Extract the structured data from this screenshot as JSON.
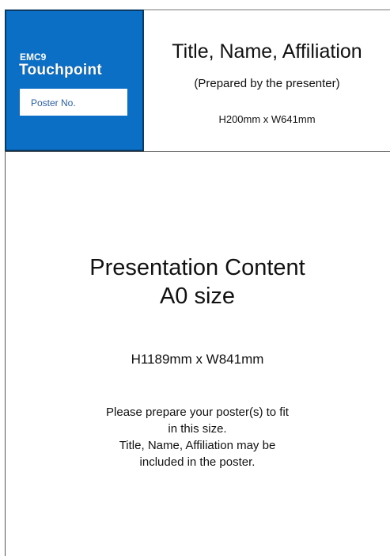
{
  "header": {
    "logo": {
      "brand_small": "EMC9",
      "brand_main": "Touchpoint",
      "poster_no_label": "Poster No."
    },
    "title": "Title, Name, Affiliation",
    "subtitle": "(Prepared by the presenter)",
    "size": "H200mm x W641mm"
  },
  "content": {
    "title_line1": "Presentation Content",
    "title_line2": "A0 size",
    "size": "H1189mm x W841mm",
    "note_lines": [
      "Please prepare your poster(s) to fit",
      "in this size.",
      "Title, Name, Affiliation may be",
      "included in the poster."
    ]
  },
  "colors": {
    "brand_blue": "#0c6fc6",
    "label_blue": "#2a5fa8",
    "border": "#555555"
  }
}
